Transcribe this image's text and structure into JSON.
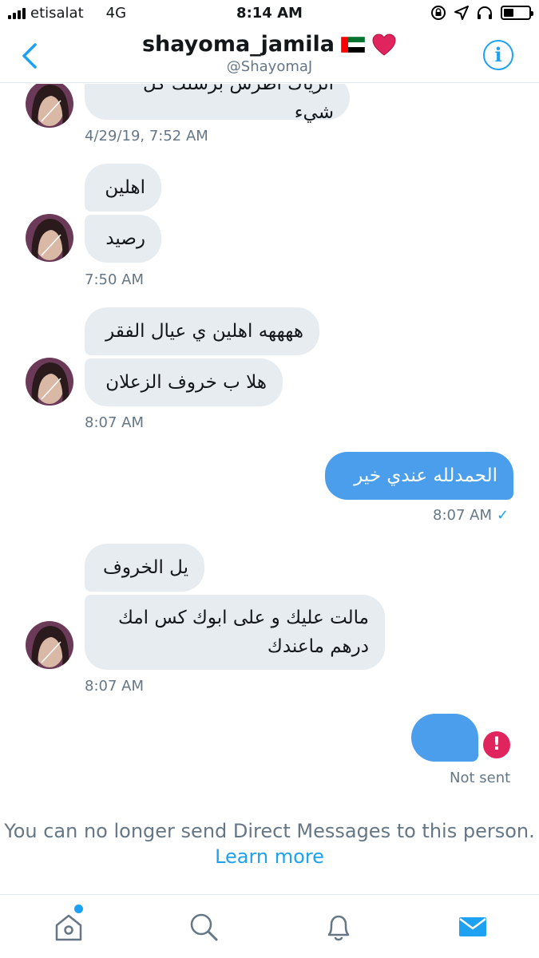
{
  "status_bar": {
    "carrier": "etisalat",
    "network": "4G",
    "time": "8:14 AM"
  },
  "header": {
    "title": "shayoma_jamila",
    "handle": "@ShayomaJ",
    "info_label": "i"
  },
  "messages": [
    {
      "text": "اترياك اطرش برسلك كل شيء"
    },
    {
      "text": "اهلين"
    },
    {
      "text": "رصيد"
    },
    {
      "text": "ههههه اهلين ي عيال الفقر"
    },
    {
      "text": "هلا ب خروف الزعلان"
    },
    {
      "text": "الحمدلله عندي خير"
    },
    {
      "text": "يل الخروف"
    },
    {
      "text": "مالت عليك و على ابوك كس امك درهم ماعندك"
    }
  ],
  "timestamps": [
    "4/29/19, 7:52 AM",
    "7:50 AM",
    "8:07 AM",
    "8:07 AM",
    "8:07 AM"
  ],
  "sent_mark": "✓",
  "error_mark": "!",
  "not_sent_label": "Not sent",
  "notice": {
    "text": "You can no longer send Direct Messages to this person.",
    "link": "Learn more"
  },
  "tabs": [
    "home-icon",
    "search-icon",
    "notifications-icon",
    "messages-icon"
  ],
  "colors": {
    "accent": "#1da1f2",
    "outgoing_bubble": "#4a9eeb",
    "incoming_bubble": "#e6ecf0",
    "error": "#e0245e"
  }
}
